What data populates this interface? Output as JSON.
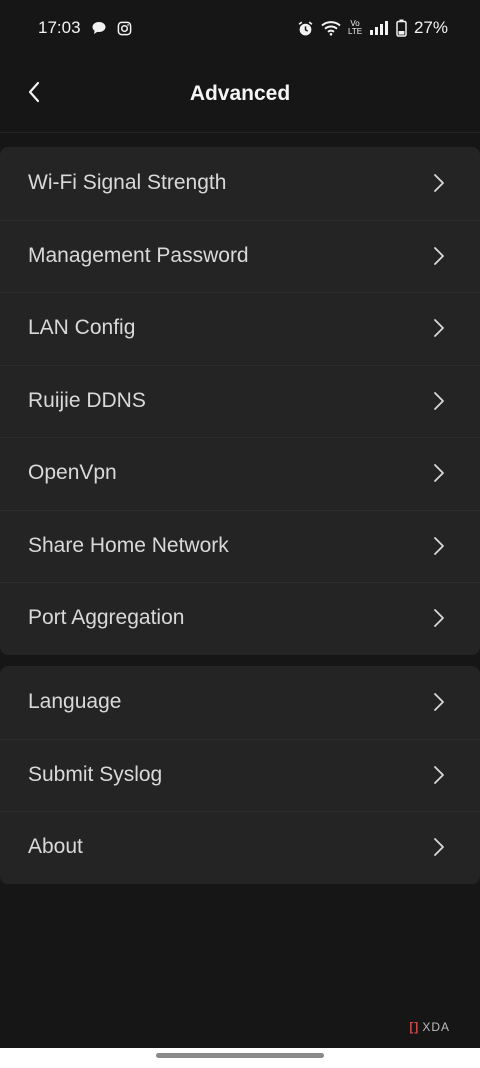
{
  "status_bar": {
    "time": "17:03",
    "network_label": "Vo LTE",
    "battery_percent": "27%"
  },
  "header": {
    "title": "Advanced",
    "back_icon": "chevron-left-icon"
  },
  "menu_group_1": [
    {
      "label": "Wi-Fi Signal Strength"
    },
    {
      "label": "Management Password"
    },
    {
      "label": "LAN Config"
    },
    {
      "label": "Ruijie DDNS"
    },
    {
      "label": "OpenVpn"
    },
    {
      "label": "Share Home Network"
    },
    {
      "label": "Port Aggregation"
    }
  ],
  "menu_group_2": [
    {
      "label": "Language"
    },
    {
      "label": "Submit Syslog"
    },
    {
      "label": "About"
    }
  ],
  "watermark": {
    "text": "XDA"
  },
  "colors": {
    "background": "#161616",
    "card": "#242424",
    "text": "#d9d9d9",
    "title": "#f5f5f5"
  }
}
